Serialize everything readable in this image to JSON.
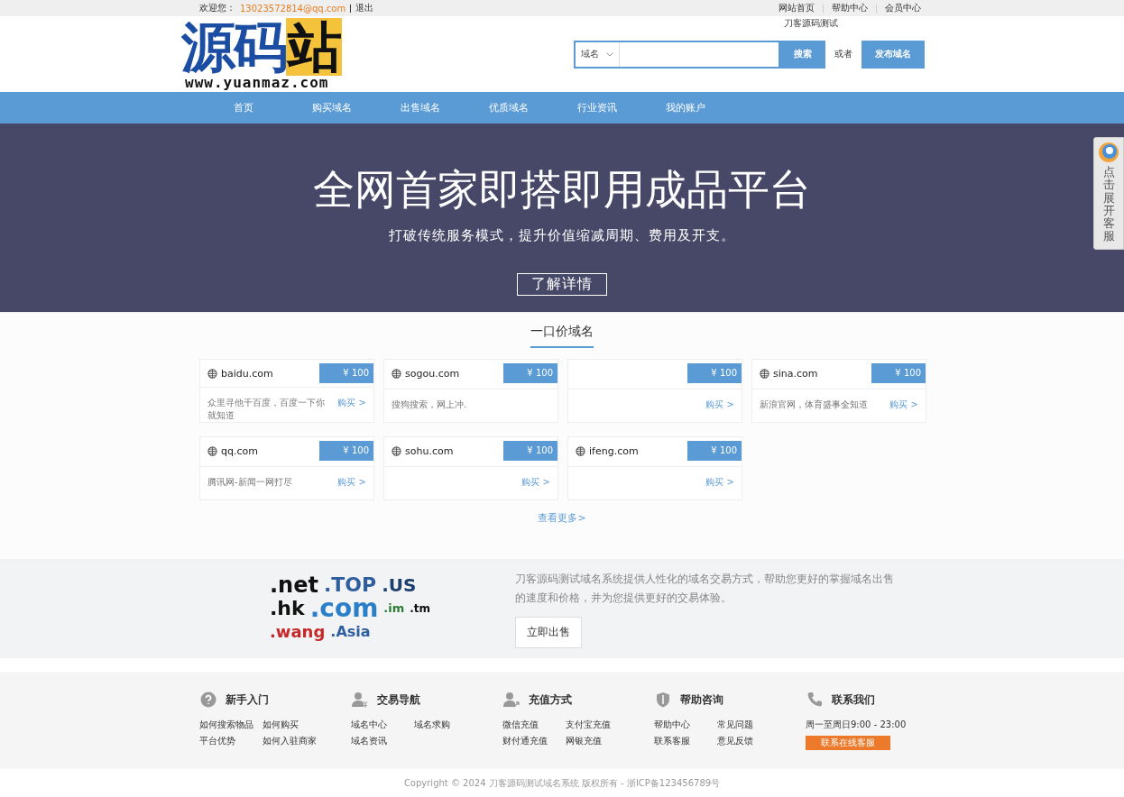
{
  "top_bar": {
    "welcome": "欢迎您：",
    "user_email": "13023572814@qq.com",
    "logout": "退出",
    "links": [
      "网站首页",
      "帮助中心",
      "会员中心"
    ]
  },
  "logo": {
    "main": "源码站",
    "url": "www.yuanmaz.com"
  },
  "search": {
    "site_name": "刀客源码测试",
    "category": "域名",
    "button": "搜索",
    "or": "或者",
    "publish_button": "发布域名"
  },
  "nav": [
    "首页",
    "购买域名",
    "出售域名",
    "优质域名",
    "行业资讯",
    "我的账户"
  ],
  "hero": {
    "title": "全网首家即搭即用成品平台",
    "subtitle": "打破传统服务模式，提升价值缩减周期、费用及开支。",
    "button": "了解详情"
  },
  "fixed_price": {
    "title": "一口价域名",
    "cards": [
      {
        "domain": "baidu.com",
        "price": "¥ 100",
        "description": "众里寻他千百度，百度一下你就知道",
        "buy": "购买 >"
      },
      {
        "domain": "sogou.com",
        "price": "¥ 100",
        "description": "搜狗搜索，网上冲."
      },
      {
        "price": "¥ 100",
        "buy": "购买 >"
      },
      {
        "domain": "sina.com",
        "price": "¥ 100",
        "description": "新浪官网，体育盛事全知道",
        "buy": "购买 >"
      },
      {
        "domain": "qq.com",
        "price": "¥ 100",
        "description": "腾讯网-新闻一网打尽",
        "buy": "购买 >"
      },
      {
        "domain": "sohu.com",
        "price": "¥ 100",
        "buy": "购买 >"
      },
      {
        "domain": "ifeng.com",
        "price": "¥ 100",
        "buy": "购买 >"
      }
    ],
    "more": "查看更多>"
  },
  "promo": {
    "logo_words": [
      ".net",
      ".TOP",
      ".US",
      ".hk",
      ".com",
      ".im",
      ".tm",
      ".wang",
      ".Asia"
    ],
    "text": "刀客源码测试域名系统提供人性化的域名交易方式，帮助您更好的掌握域名出售的速度和价格，并为您提供更好的交易体验。",
    "button": "立即出售"
  },
  "footer": {
    "columns": [
      {
        "kind": "question",
        "title": "新手入门",
        "links": [
          "如何搜索物品",
          "如何购买",
          "平台优势",
          "如何入驻商家"
        ]
      },
      {
        "kind": "trade",
        "title": "交易导航",
        "links": [
          "域名中心",
          "域名求购",
          "域名资讯"
        ]
      },
      {
        "kind": "recharge",
        "title": "充值方式",
        "links": [
          "微信充值",
          "支付宝充值",
          "财付通充值",
          "网银充值"
        ]
      },
      {
        "kind": "shield",
        "title": "帮助咨询",
        "links": [
          "帮助中心",
          "常见问题",
          "联系客服",
          "意见反馈"
        ]
      }
    ],
    "contact": {
      "title": "联系我们",
      "hours": "周一至周日9:00 - 23:00",
      "button": "联系在线客服"
    },
    "copyright": "Copyright © 2024 刀客源码测试域名系统 版权所有 - 浙ICP备123456789号"
  },
  "side_service": {
    "label": "点击展开客服"
  }
}
